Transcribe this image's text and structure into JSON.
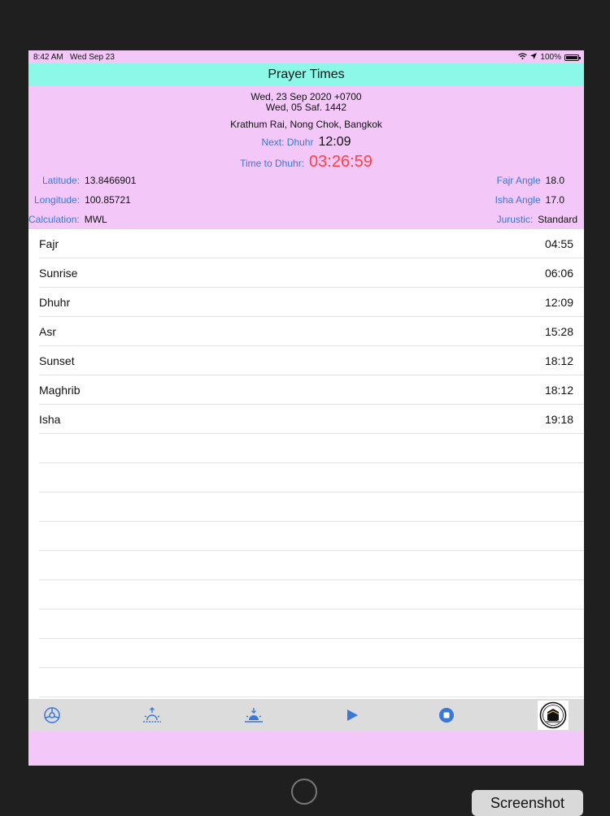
{
  "status_bar": {
    "time": "8:42 AM",
    "date": "Wed Sep 23",
    "battery": "100%"
  },
  "nav": {
    "title": "Prayer Times"
  },
  "header": {
    "gregorian_date": "Wed, 23 Sep 2020 +0700",
    "hijri_date": "Wed, 05 Saf. 1442",
    "location": "Krathum Rai, Nong Chok, Bangkok",
    "next_label": "Next: Dhuhr",
    "next_time": "12:09",
    "countdown_label": "Time to Dhuhr:",
    "countdown_value": "03:26:59"
  },
  "params": {
    "latitude_label": "Latitude:",
    "latitude_value": "13.8466901",
    "longitude_label": "Longitude:",
    "longitude_value": "100.85721",
    "calculation_label": "Calculation:",
    "calculation_value": "MWL",
    "fajr_angle_label": "Fajr Angle",
    "fajr_angle_value": "18.0",
    "isha_angle_label": "Isha Angle",
    "isha_angle_value": "17.0",
    "jurustic_label": "Jurustic:",
    "jurustic_value": "Standard"
  },
  "prayers": [
    {
      "name": "Fajr",
      "time": "04:55"
    },
    {
      "name": "Sunrise",
      "time": "06:06"
    },
    {
      "name": "Dhuhr",
      "time": "12:09"
    },
    {
      "name": "Asr",
      "time": "15:28"
    },
    {
      "name": "Sunset",
      "time": "18:12"
    },
    {
      "name": "Maghrib",
      "time": "18:12"
    },
    {
      "name": "Isha",
      "time": "19:18"
    }
  ],
  "toolbar": {
    "icons": [
      "settings-icon",
      "sunrise-icon",
      "sunset-icon",
      "play-icon",
      "stop-icon",
      "kaaba-logo-icon"
    ],
    "accent": "#3a78d8"
  },
  "overlay": {
    "screenshot_label": "Screenshot"
  },
  "colors": {
    "nav_bg": "#8cf8e7",
    "header_bg": "#f3c8f8",
    "countdown": "#ff4040",
    "label_blue": "#3a78d8"
  }
}
